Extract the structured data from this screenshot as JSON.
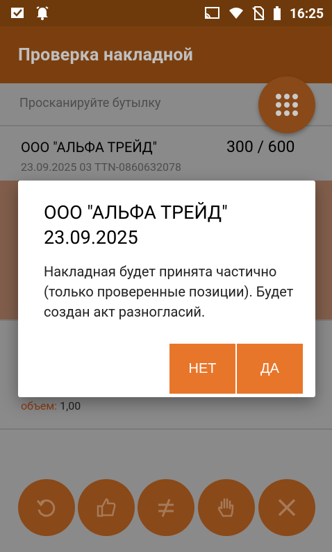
{
  "status_bar": {
    "time": "16:25",
    "icons": [
      "checkbox-icon",
      "alarm-icon",
      "cast-icon",
      "wifi-icon",
      "no-sim-icon",
      "battery-icon"
    ]
  },
  "app_bar": {
    "title": "Проверка накладной"
  },
  "main": {
    "scan_hint": "Просканируйте бутылку",
    "invoice": {
      "name": "ООО \"АЛЬФА ТРЕЙД\"",
      "count": "300 / 600",
      "subtitle": "23.09.2025 03 TTN-0860632078"
    },
    "volume": {
      "label": "объем:",
      "value": "1,00"
    }
  },
  "dialog": {
    "title": "ООО \"АЛЬФА ТРЕЙД\" 23.09.2025",
    "message": "Накладная будет принята частично (только проверенные позиции). Будет создан акт разногласий.",
    "no_label": "НЕТ",
    "yes_label": "ДА"
  },
  "bottom_actions": [
    "refresh-icon",
    "thumbs-up-icon",
    "not-equal-icon",
    "hand-stop-icon",
    "close-icon"
  ],
  "colors": {
    "accent": "#e8762a",
    "app_bar_dimmed": "#7b3f0f",
    "fab_dimmed": "#8a4919",
    "overlay_content": "#8a8a8a"
  }
}
